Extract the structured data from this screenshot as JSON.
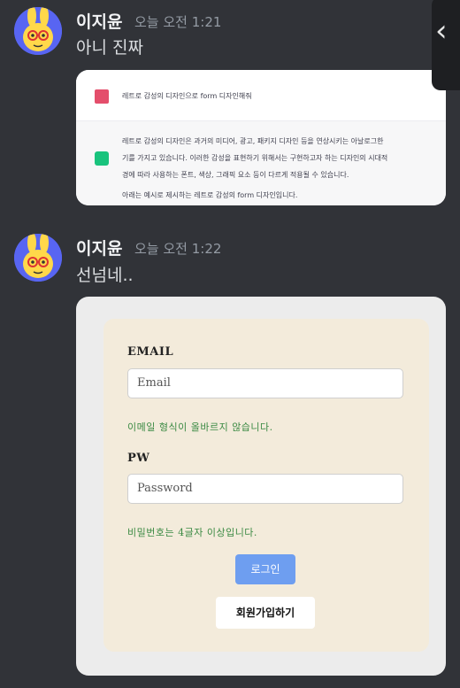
{
  "messages": [
    {
      "username": "이지윤",
      "time": "오늘 오전 1:21",
      "text": "아니 진짜"
    },
    {
      "username": "이지윤",
      "time": "오늘 오전 1:22",
      "text": "선넘네.."
    }
  ],
  "embed1": {
    "user_prompt": "레트로 감성의 디자인으로 form 디자인해줘",
    "reply_lines": [
      "레트로 감성의 디자인은 과거의 미디어, 광고, 패키지 디자인 등을 연상시키는 아날로그한",
      "기를 가지고 있습니다. 이러한 감성을 표현하기 위해서는 구현하고자 하는 디자인의 시대적",
      "경에 따라 사용하는 폰트, 색상, 그래픽 요소 등이 다르게 적용될 수 있습니다.",
      "아래는 예시로 제시하는 레트로 감성의 form 디자인입니다."
    ]
  },
  "form": {
    "email_label": "EMAIL",
    "email_placeholder": "Email",
    "email_error": "이메일 형식이 올바르지 않습니다.",
    "pw_label": "PW",
    "pw_placeholder": "Password",
    "pw_error": "비밀번호는 4글자 이상입니다.",
    "login_button": "로그인",
    "signup_button": "회원가입하기"
  },
  "overlay": {
    "chevron": "‹",
    "icon": "chevron-left-icon"
  }
}
